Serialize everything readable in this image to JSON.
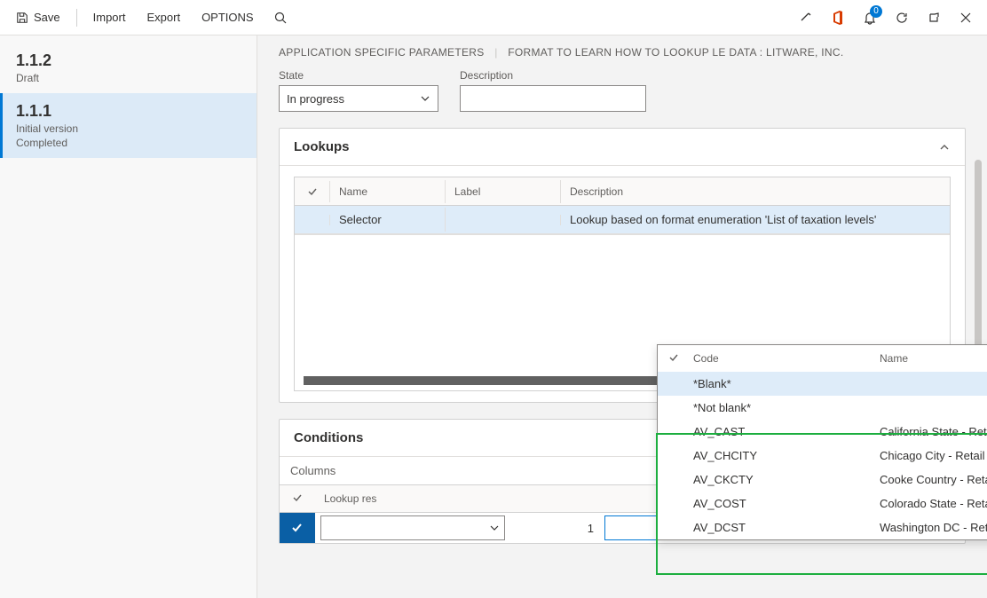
{
  "toolbar": {
    "save": "Save",
    "import": "Import",
    "export": "Export",
    "options": "OPTIONS",
    "badge_count": "0"
  },
  "sidebar": {
    "items": [
      {
        "title": "1.1.2",
        "sub1": "Draft",
        "sub2": ""
      },
      {
        "title": "1.1.1",
        "sub1": "Initial version",
        "sub2": "Completed"
      }
    ]
  },
  "breadcrumb": {
    "left": "APPLICATION SPECIFIC PARAMETERS",
    "right": "FORMAT TO LEARN HOW TO LOOKUP LE DATA : LITWARE, INC."
  },
  "fields": {
    "state_label": "State",
    "state_value": "In progress",
    "desc_label": "Description",
    "desc_value": ""
  },
  "lookups": {
    "title": "Lookups",
    "cols": {
      "name": "Name",
      "label": "Label",
      "desc": "Description"
    },
    "row": {
      "name": "Selector",
      "label": "",
      "desc": "Lookup based on format enumeration 'List of taxation levels'"
    }
  },
  "conditions": {
    "title": "Conditions",
    "columns_label": "Columns",
    "cols": {
      "lookup": "Lookup res",
      "line": "",
      "code": ""
    },
    "row": {
      "line": "1"
    }
  },
  "popup": {
    "cols": {
      "code": "Code",
      "name": "Name"
    },
    "rows": [
      {
        "code": "*Blank*",
        "name": ""
      },
      {
        "code": "*Not blank*",
        "name": ""
      },
      {
        "code": "AV_CAST",
        "name": "California State - Retail Prod"
      },
      {
        "code": "AV_CHCITY",
        "name": "Chicago City - Retail Prod"
      },
      {
        "code": "AV_CKCTY",
        "name": "Cooke Country - Retail Prod"
      },
      {
        "code": "AV_COST",
        "name": "Colorado State - Retail Prod"
      },
      {
        "code": "AV_DCST",
        "name": "Washington DC - Retail Prod"
      }
    ]
  }
}
